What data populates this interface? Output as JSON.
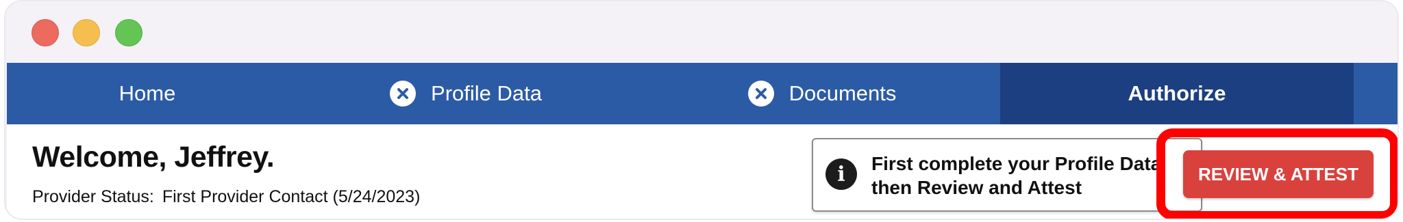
{
  "window": {
    "controls": [
      "close",
      "minimize",
      "zoom"
    ]
  },
  "nav": {
    "tabs": [
      {
        "label": "Home",
        "icon": ""
      },
      {
        "label": "Profile Data",
        "icon": "x-circle-icon"
      },
      {
        "label": "Documents",
        "icon": "x-circle-icon"
      },
      {
        "label": "Authorize",
        "icon": "",
        "active": true
      }
    ]
  },
  "main": {
    "welcome": "Welcome, Jeffrey.",
    "status_label": "Provider Status:",
    "status_value": "First Provider Contact (5/24/2023)"
  },
  "notice": {
    "icon": "info-icon",
    "line1": "First complete your Profile Data",
    "line2": "then Review and Attest"
  },
  "actions": {
    "review_attest_label": "REVIEW & ATTEST"
  },
  "colors": {
    "nav_bg": "#2c5ba6",
    "nav_active_bg": "#1b3f80",
    "button_bg": "#d9413d",
    "highlight": "#ff0000"
  }
}
